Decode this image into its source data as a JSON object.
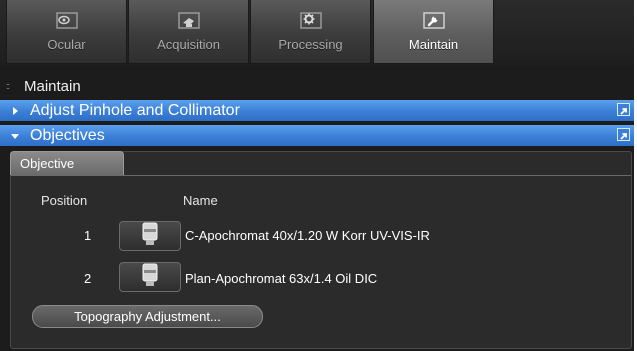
{
  "tabs": [
    {
      "label": "Ocular",
      "icon": "eye-icon",
      "active": false
    },
    {
      "label": "Acquisition",
      "icon": "camera-icon",
      "active": false
    },
    {
      "label": "Processing",
      "icon": "gear-icon",
      "active": false
    },
    {
      "label": "Maintain",
      "icon": "wrench-icon",
      "active": true
    }
  ],
  "section": {
    "title": "Maintain",
    "grip": "::"
  },
  "bars": {
    "pinhole": {
      "label": "Adjust Pinhole and Collimator",
      "expanded": false
    },
    "objectives": {
      "label": "Objectives",
      "expanded": true
    }
  },
  "panel": {
    "subtab": "Objective",
    "headers": {
      "position": "Position",
      "name": "Name"
    },
    "rows": [
      {
        "position": "1",
        "name": "C-Apochromat 40x/1.20 W Korr UV-VIS-IR"
      },
      {
        "position": "2",
        "name": "Plan-Apochromat 63x/1.4 Oil DIC"
      }
    ],
    "topography_button": "Topography Adjustment..."
  },
  "colors": {
    "accent_blue": "#3b7fd6",
    "background": "#1c1c1c",
    "panel": "#2b2b2b"
  }
}
